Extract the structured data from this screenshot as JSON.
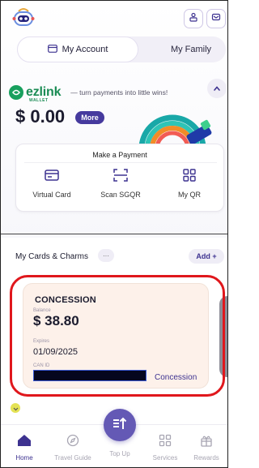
{
  "header": {
    "logo": "app-mascot-logo",
    "icons": [
      "person-icon",
      "inbox-icon"
    ]
  },
  "tabs": [
    {
      "label": "My Account",
      "icon": "card-icon",
      "active": true
    },
    {
      "label": "My Family",
      "active": false
    }
  ],
  "wallet": {
    "brand_word": "ezlink",
    "brand_sub": "WALLET",
    "tagline": "— turn payments into little wins!",
    "balance": "$ 0.00",
    "more_label": "More"
  },
  "payment": {
    "title": "Make a Payment",
    "actions": [
      {
        "label": "Virtual Card",
        "icon": "virtual-card-icon"
      },
      {
        "label": "Scan SGQR",
        "icon": "scan-qr-icon"
      },
      {
        "label": "My QR",
        "icon": "my-qr-icon"
      }
    ]
  },
  "cards_section": {
    "title": "My Cards & Charms",
    "dots": "···",
    "add_label": "Add +"
  },
  "card": {
    "title": "CONCESSION",
    "balance_label": "Balance",
    "balance": "$ 38.80",
    "expires_label": "Expires",
    "expiry": "01/09/2025",
    "can_label": "CAN ID",
    "type": "Concession",
    "highlight_color": "#e0171c"
  },
  "nav": [
    {
      "label": "Home",
      "icon": "home-icon",
      "active": true
    },
    {
      "label": "Travel Guide",
      "icon": "compass-icon",
      "active": false
    },
    {
      "label": "Top Up",
      "icon": "top-up-icon",
      "active": false
    },
    {
      "label": "Services",
      "icon": "grid-icon",
      "active": false
    },
    {
      "label": "Rewards",
      "icon": "gift-icon",
      "active": false
    }
  ],
  "colors": {
    "accent": "#463a9e",
    "brand_green": "#18a05e",
    "card_bg": "#fdf1ea"
  }
}
